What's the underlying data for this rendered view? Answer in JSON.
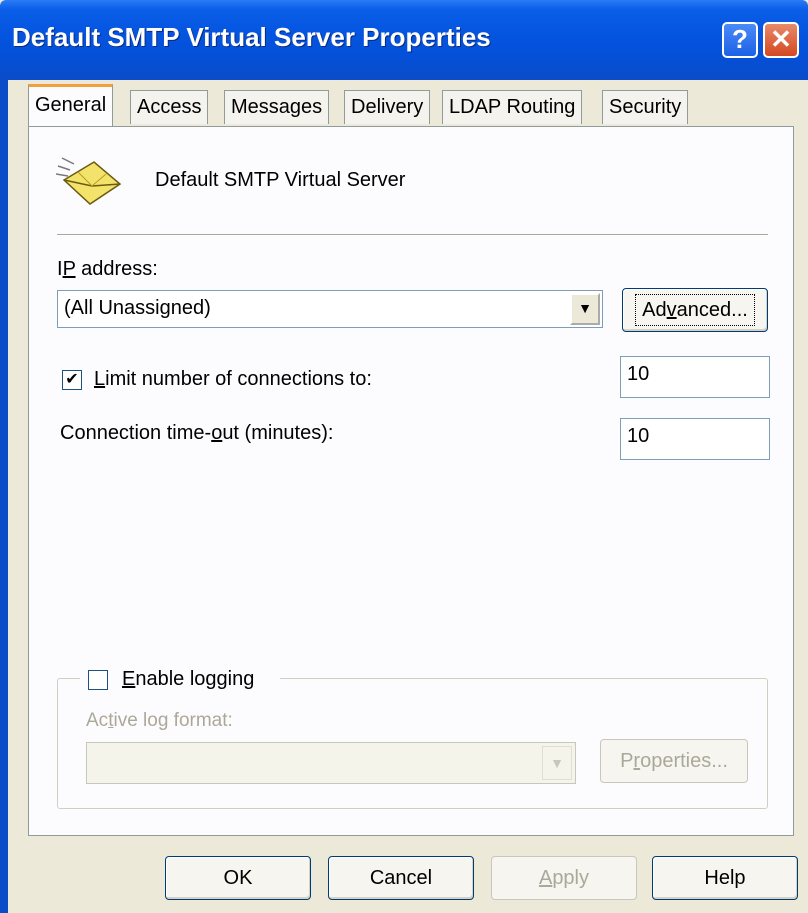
{
  "window": {
    "title": "Default SMTP Virtual Server Properties",
    "help_glyph": "?",
    "close_glyph": "✕"
  },
  "tabs": [
    {
      "label": "General",
      "active": true
    },
    {
      "label": "Access"
    },
    {
      "label": "Messages"
    },
    {
      "label": "Delivery"
    },
    {
      "label": "LDAP Routing"
    },
    {
      "label": "Security"
    }
  ],
  "general": {
    "server_name": "Default SMTP Virtual Server",
    "server_icon": "envelope-icon",
    "ip_label_prefix": "I",
    "ip_label_ul": "P",
    "ip_label_rest": " address:",
    "ip_value": "(All Unassigned)",
    "advanced_prefix": "Ad",
    "advanced_ul": "v",
    "advanced_rest": "anced...",
    "limit_checked": "✔",
    "limit_ul": "L",
    "limit_rest": "imit number of connections to:",
    "limit_value": "10",
    "timeout_prefix": "Connection time-",
    "timeout_ul": "o",
    "timeout_rest": "ut (minutes):",
    "timeout_value": "10",
    "logging_ul": "E",
    "logging_rest": "nable logging",
    "log_format_prefix": "Ac",
    "log_format_ul": "t",
    "log_format_rest": "ive log format:",
    "log_format_value": "",
    "properties_prefix": "P",
    "properties_ul": "r",
    "properties_rest": "operties..."
  },
  "footer": {
    "ok": "OK",
    "cancel": "Cancel",
    "apply_ul": "A",
    "apply_rest": "pply",
    "help": "Help"
  },
  "colors": {
    "titlebar": "#0555e0",
    "dialog": "#ECE9D8",
    "active_tab_accent": "#f0a03c",
    "disabled_text": "#aca899"
  }
}
